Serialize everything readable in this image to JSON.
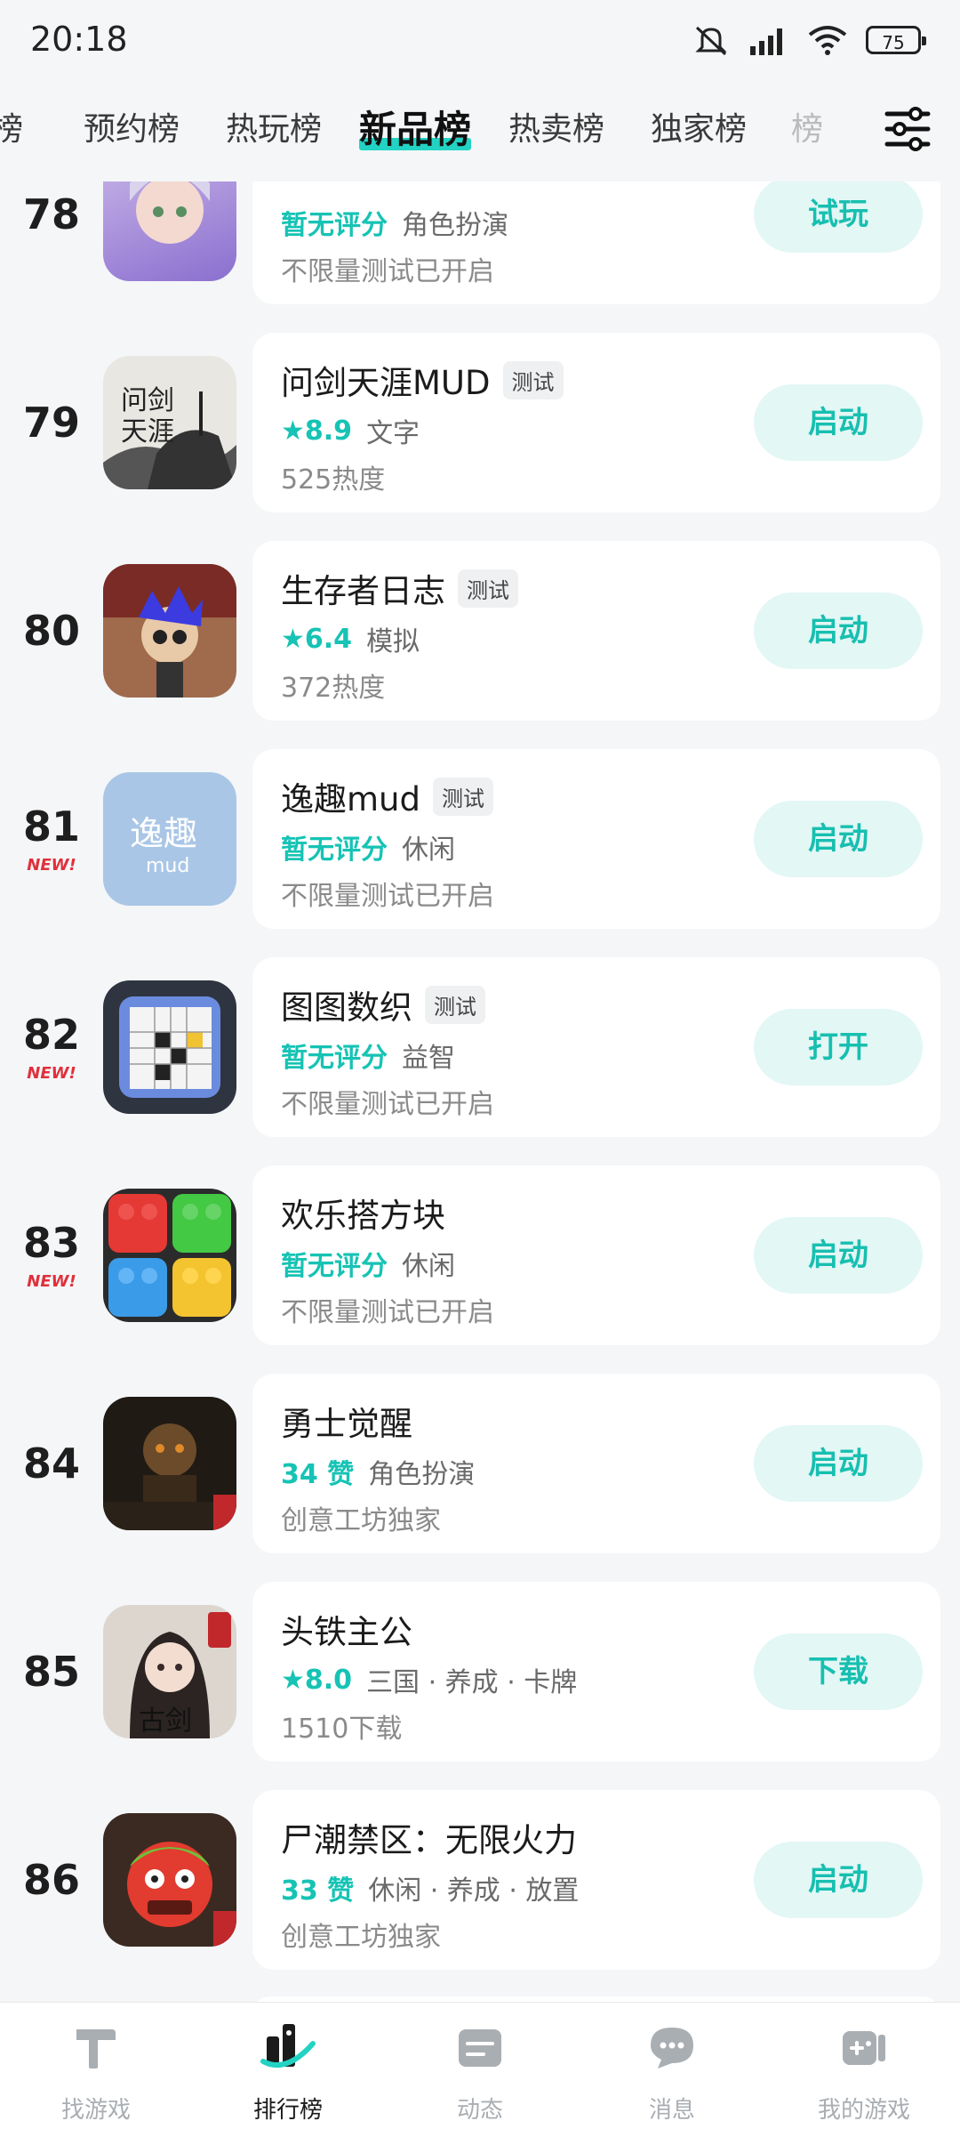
{
  "status": {
    "time": "20:18",
    "battery": "75"
  },
  "tabs": [
    {
      "label": "榜",
      "state": "partial"
    },
    {
      "label": "预约榜",
      "state": "normal"
    },
    {
      "label": "热玩榜",
      "state": "normal"
    },
    {
      "label": "新品榜",
      "state": "active"
    },
    {
      "label": "热卖榜",
      "state": "normal"
    },
    {
      "label": "独家榜",
      "state": "normal"
    },
    {
      "label": "榜",
      "state": "fade"
    }
  ],
  "games": [
    {
      "rank": "78",
      "new": "",
      "title": "",
      "tag": "",
      "score": "暂无评分",
      "score_star": false,
      "category": "角色扮演",
      "sub": "不限量测试已开启",
      "action": "试玩",
      "icon": "anime-girl-icon"
    },
    {
      "rank": "79",
      "new": "",
      "title": "问剑天涯MUD",
      "tag": "测试",
      "score": "8.9",
      "score_star": true,
      "category": "文字",
      "sub": "525热度",
      "action": "启动",
      "icon": "ink-swordsman-icon"
    },
    {
      "rank": "80",
      "new": "",
      "title": "生存者日志",
      "tag": "测试",
      "score": "6.4",
      "score_star": true,
      "category": "模拟",
      "sub": "372热度",
      "action": "启动",
      "icon": "survivor-cartoon-icon"
    },
    {
      "rank": "81",
      "new": "NEW!",
      "title": "逸趣mud",
      "tag": "测试",
      "score": "暂无评分",
      "score_star": false,
      "category": "休闲",
      "sub": "不限量测试已开启",
      "action": "启动",
      "icon": "yiqu-logo-icon"
    },
    {
      "rank": "82",
      "new": "NEW!",
      "title": "图图数织",
      "tag": "测试",
      "score": "暂无评分",
      "score_star": false,
      "category": "益智",
      "sub": "不限量测试已开启",
      "action": "打开",
      "icon": "nonogram-grid-icon"
    },
    {
      "rank": "83",
      "new": "NEW!",
      "title": "欢乐搭方块",
      "tag": "",
      "score": "暂无评分",
      "score_star": false,
      "category": "休闲",
      "sub": "不限量测试已开启",
      "action": "启动",
      "icon": "lego-blocks-icon"
    },
    {
      "rank": "84",
      "new": "",
      "title": "勇士觉醒",
      "tag": "",
      "score": "34 赞",
      "score_star": false,
      "category": "角色扮演",
      "sub": "创意工坊独家",
      "action": "启动",
      "icon": "dark-warrior-icon"
    },
    {
      "rank": "85",
      "new": "",
      "title": "头铁主公",
      "tag": "",
      "score": "8.0",
      "score_star": true,
      "category": "三国 · 养成 · 卡牌",
      "sub": "1510下载",
      "action": "下载",
      "icon": "ancient-sword-girl-icon"
    },
    {
      "rank": "86",
      "new": "",
      "title": "尸潮禁区：无限火力",
      "tag": "",
      "score": "33 赞",
      "score_star": false,
      "category": "休闲 · 养成 · 放置",
      "sub": "创意工坊独家",
      "action": "启动",
      "icon": "zombie-face-icon"
    }
  ],
  "bottom_nav": [
    {
      "label": "找游戏",
      "icon": "hammer-icon"
    },
    {
      "label": "排行榜",
      "icon": "trophy-chart-icon",
      "active": true
    },
    {
      "label": "动态",
      "icon": "feed-card-icon"
    },
    {
      "label": "消息",
      "icon": "chat-bubble-icon"
    },
    {
      "label": "我的游戏",
      "icon": "gamepad-icon"
    }
  ],
  "colors": {
    "accent": "#16c3b4",
    "button_bg": "#e3f7f5",
    "new_red": "#e0303a"
  }
}
